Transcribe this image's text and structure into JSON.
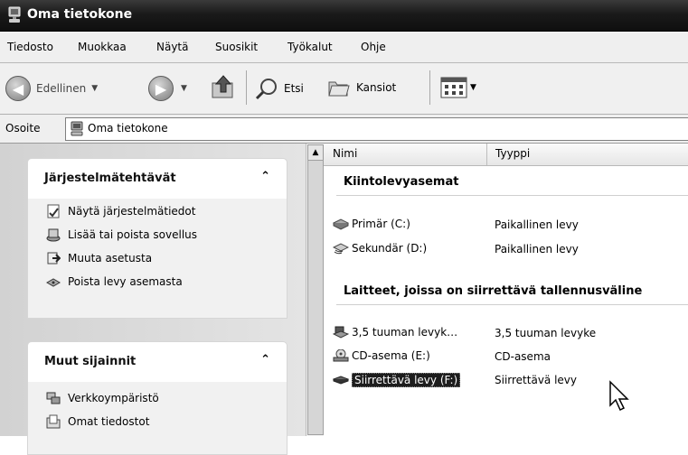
{
  "window": {
    "title": "Oma tietokone"
  },
  "menu": [
    "Tiedosto",
    "Muokkaa",
    "Näytä",
    "Suosikit",
    "Työkalut",
    "Ohje"
  ],
  "toolbar": {
    "back_label": "Edellinen",
    "search_label": "Etsi",
    "folders_label": "Kansiot"
  },
  "address": {
    "label": "Osoite",
    "value": "Oma tietokone"
  },
  "sidebar": {
    "system_tasks": {
      "title": "Järjestelmätehtävät",
      "collapse": "⌃",
      "items": [
        "Näytä järjestelmätiedot",
        "Lisää tai poista sovellus",
        "Muuta asetusta",
        "Poista levy asemasta"
      ]
    },
    "other_places": {
      "title": "Muut sijainnit",
      "collapse": "⌃",
      "items": [
        "Verkkoympäristö",
        "Omat tiedostot"
      ]
    }
  },
  "columns": {
    "name": "Nimi",
    "type": "Tyyppi"
  },
  "groups": [
    {
      "title": "Kiintolevyasemat",
      "items": [
        {
          "name": "Primär (C:)",
          "type": "Paikallinen levy",
          "icon": "hard-drive-icon"
        },
        {
          "name": "Sekundär (D:)",
          "type": "Paikallinen levy",
          "icon": "shared-drive-icon"
        }
      ]
    },
    {
      "title": "Laitteet, joissa on siirrettävä tallennusväline",
      "items": [
        {
          "name": "3,5 tuuman levyk…",
          "type": "3,5 tuuman levyke",
          "icon": "floppy-drive-icon"
        },
        {
          "name": "CD-asema (E:)",
          "type": "CD-asema",
          "icon": "cd-drive-icon"
        },
        {
          "name": "Siirrettävä levy (F:)",
          "type": "Siirrettävä levy",
          "icon": "removable-drive-icon",
          "selected": true
        }
      ]
    }
  ]
}
